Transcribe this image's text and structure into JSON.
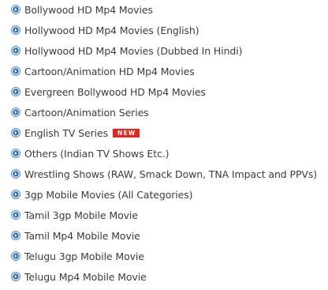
{
  "colors": {
    "bullet_ring": "#5b8fbf",
    "bullet_fill": "#2b6cae",
    "text": "#3b3b3b",
    "badge_bg": "#e8251d",
    "badge_text": "#ffffff"
  },
  "bullet_icon": "blue-circle-arrow-icon",
  "items": [
    {
      "label": "Bollywood HD Mp4 Movies"
    },
    {
      "label": "Hollywood HD Mp4 Movies (English)"
    },
    {
      "label": "Hollywood HD Mp4 Movies (Dubbed In Hindi)"
    },
    {
      "label": "Cartoon/Animation HD Mp4 Movies"
    },
    {
      "label": "Evergreen Bollywood HD Mp4 Movies"
    },
    {
      "label": "Cartoon/Animation Series"
    },
    {
      "label": "English TV Series",
      "badge": "NEW"
    },
    {
      "label": "Others (Indian TV Shows Etc.)"
    },
    {
      "label": "Wrestling Shows (RAW, Smack Down, TNA Impact and PPVs)"
    },
    {
      "label": "3gp Mobile Movies (All Categories)"
    },
    {
      "label": "Tamil 3gp Mobile Movie"
    },
    {
      "label": "Tamil Mp4 Mobile Movie"
    },
    {
      "label": "Telugu 3gp Mobile Movie"
    },
    {
      "label": "Telugu Mp4 Mobile Movie"
    }
  ]
}
